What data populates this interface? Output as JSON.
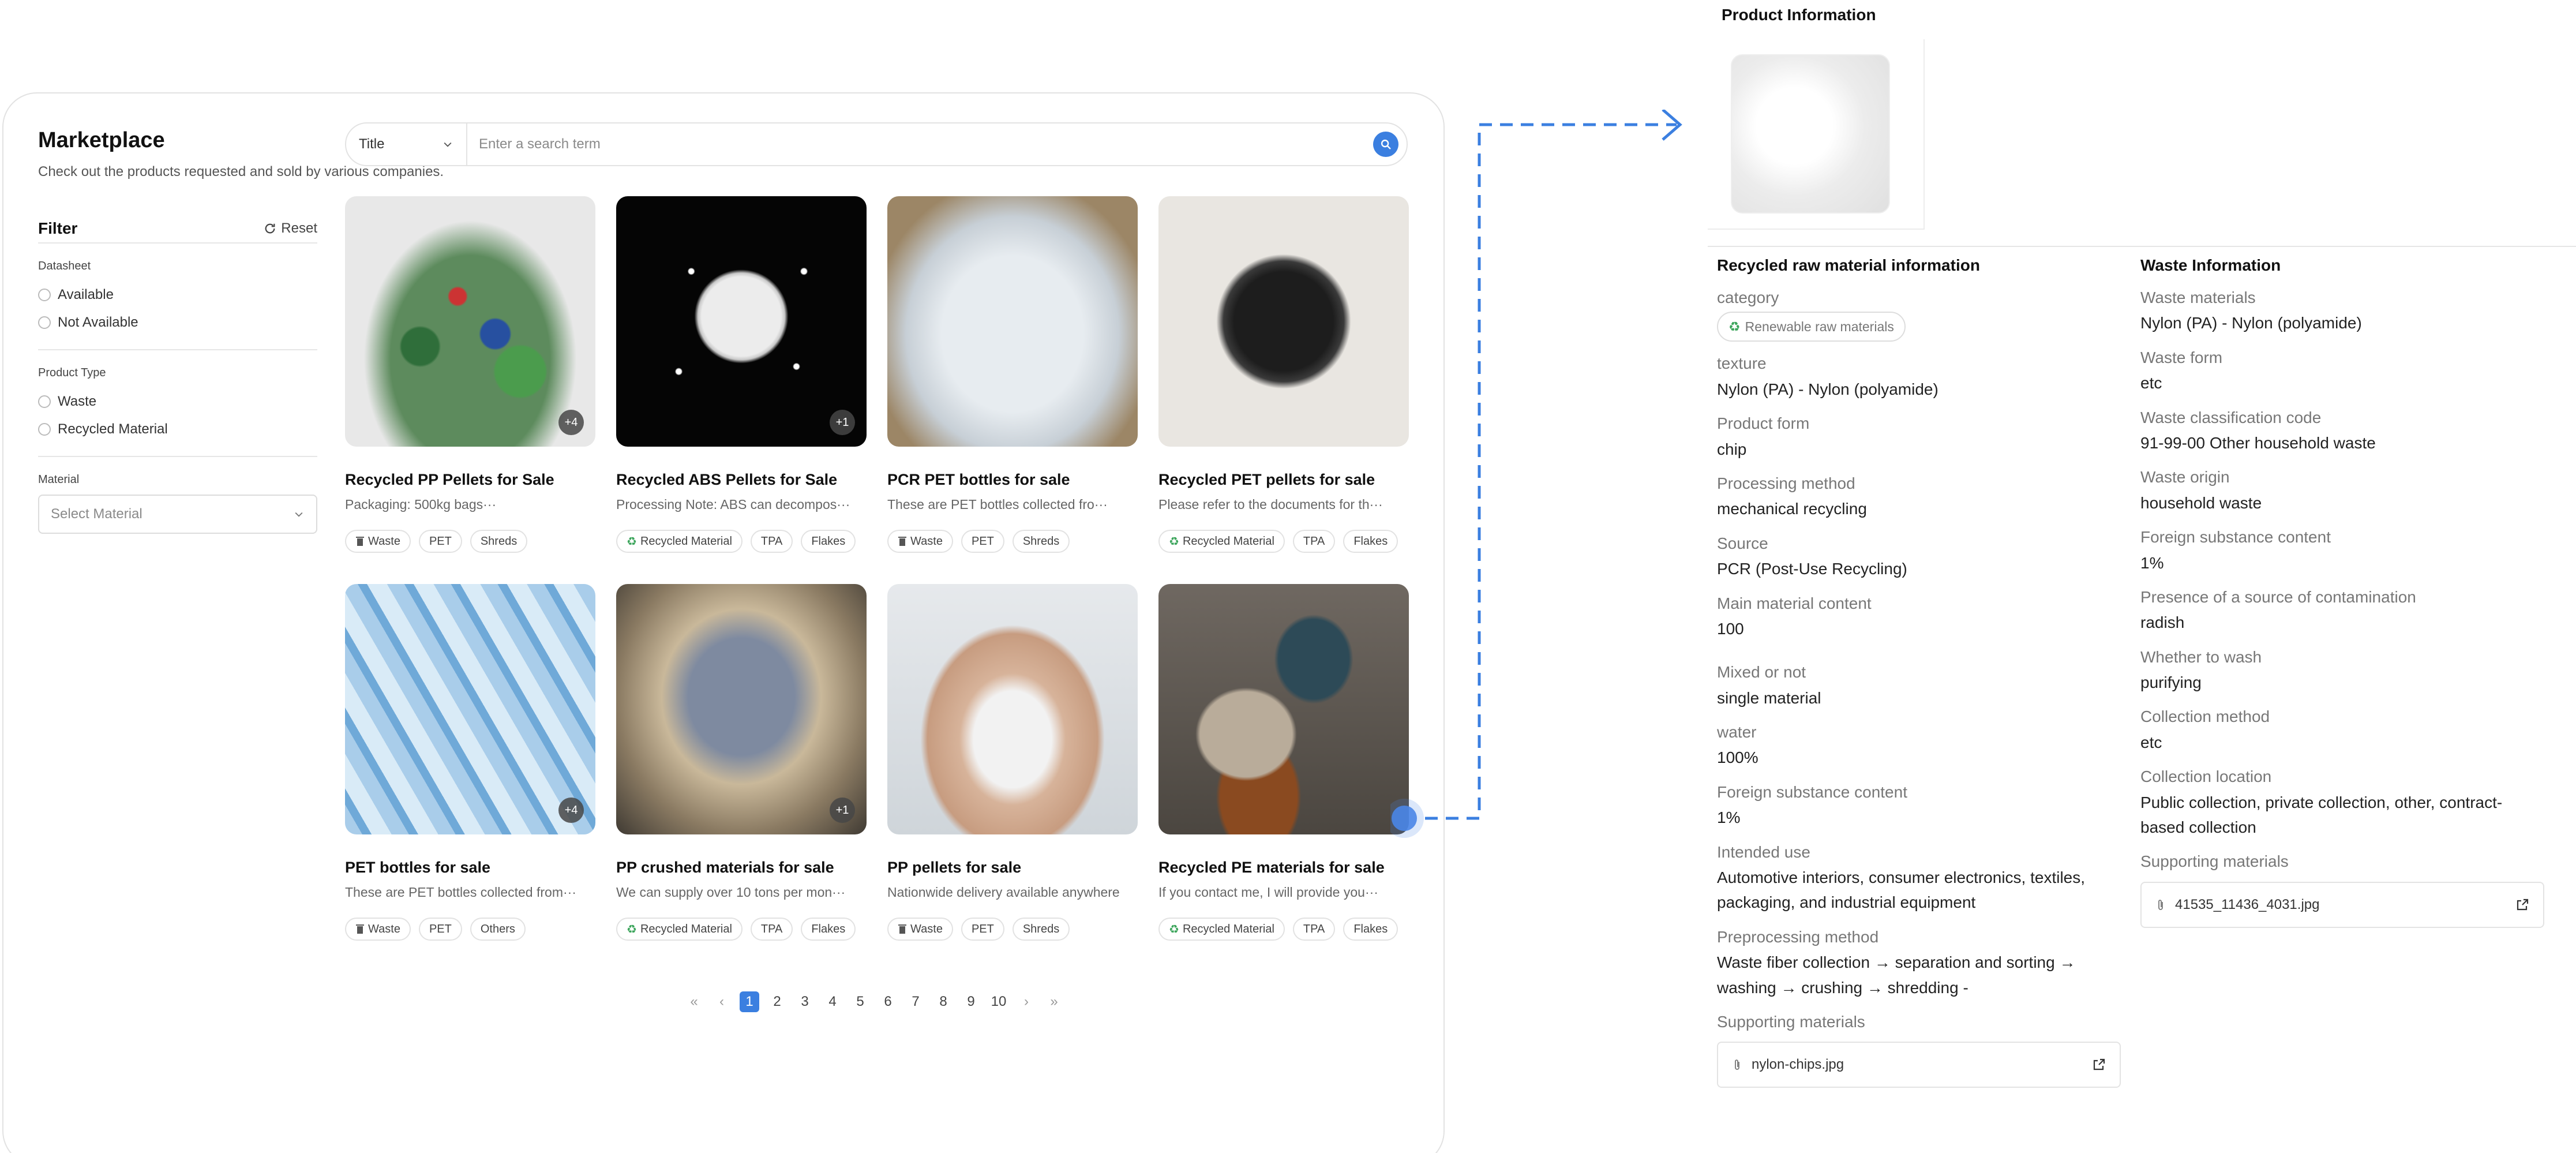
{
  "marketplace": {
    "title": "Marketplace",
    "subtitle": "Check out the products requested and sold by various companies."
  },
  "filter": {
    "title": "Filter",
    "reset_label": "Reset",
    "datasheet": {
      "label": "Datasheet",
      "options": [
        "Available",
        "Not Available"
      ]
    },
    "product_type": {
      "label": "Product Type",
      "options": [
        "Waste",
        "Recycled Material"
      ]
    },
    "material": {
      "label": "Material",
      "placeholder": "Select Material"
    }
  },
  "search": {
    "field": "Title",
    "placeholder": "Enter a search term"
  },
  "products": [
    {
      "title": "Recycled PP Pellets for Sale",
      "desc": "Packaging: 500kg bags···",
      "badge": "+4",
      "tags": [
        "Waste",
        "PET",
        "Shreds"
      ],
      "type_icon": "trash-icon",
      "image": "mixed-plastic-shreds"
    },
    {
      "title": "Recycled ABS Pellets for Sale",
      "desc": "Processing Note: ABS can decompos···",
      "badge": "+1",
      "tags": [
        "Recycled Material",
        "TPA",
        "Flakes"
      ],
      "type_icon": "recycle-icon",
      "image": "white-pellets-on-black"
    },
    {
      "title": "PCR PET bottles for sale",
      "desc": "These are PET bottles collected fro···",
      "badge": "",
      "tags": [
        "Waste",
        "PET",
        "Shreds"
      ],
      "type_icon": "trash-icon",
      "image": "clear-bottles-in-bag"
    },
    {
      "title": "Recycled PET pellets for sale",
      "desc": "Please refer to the documents for th···",
      "badge": "",
      "tags": [
        "Recycled Material",
        "TPA",
        "Flakes"
      ],
      "type_icon": "recycle-icon",
      "image": "black-pellets"
    },
    {
      "title": "PET bottles for sale",
      "desc": "These are PET bottles collected from···",
      "badge": "+4",
      "tags": [
        "Waste",
        "PET",
        "Others"
      ],
      "type_icon": "trash-icon",
      "image": "blue-bottles"
    },
    {
      "title": "PP crushed materials for sale",
      "desc": "We can supply over 10 tons per mon···",
      "badge": "+1",
      "tags": [
        "Recycled Material",
        "TPA",
        "Flakes"
      ],
      "type_icon": "recycle-icon",
      "image": "crushed-plastic-bag"
    },
    {
      "title": "PP pellets for sale",
      "desc": "Nationwide delivery available anywhere",
      "badge": "",
      "tags": [
        "Waste",
        "PET",
        "Shreds"
      ],
      "type_icon": "trash-icon",
      "image": "hand-clear-pellets"
    },
    {
      "title": "Recycled PE materials for sale",
      "desc": "If you contact me, I will provide you···",
      "badge": "",
      "tags": [
        "Recycled Material",
        "TPA",
        "Flakes"
      ],
      "type_icon": "recycle-icon",
      "image": "pellets-in-glasses"
    }
  ],
  "pagination": {
    "pages": [
      "1",
      "2",
      "3",
      "4",
      "5",
      "6",
      "7",
      "8",
      "9",
      "10"
    ],
    "current": "1"
  },
  "product_info": {
    "title": "Product Information",
    "recycled": {
      "title": "Recycled raw material information",
      "category_label": "category",
      "category_value": "Renewable raw materials",
      "fields": [
        {
          "label": "texture",
          "value": "Nylon (PA) - Nylon (polyamide)"
        },
        {
          "label": "Product form",
          "value": "chip"
        },
        {
          "label": "Processing method",
          "value": "mechanical recycling"
        },
        {
          "label": "Source",
          "value": "PCR (Post-Use Recycling)"
        },
        {
          "label": "Main material content",
          "value": "100"
        },
        {
          "label": "Mixed or not",
          "value": "single material"
        },
        {
          "label": "water",
          "value": "100%"
        },
        {
          "label": "Foreign substance content",
          "value": "1%"
        },
        {
          "label": "Intended use",
          "value": "Automotive interiors, consumer electronics, textiles, packaging, and industrial equipment"
        },
        {
          "label": "Preprocessing method",
          "value": "Waste fiber collection → separation and sorting → washing → crushing → shredding -"
        }
      ],
      "supporting_label": "Supporting materials",
      "file": "nylon-chips.jpg"
    },
    "waste": {
      "title": "Waste Information",
      "fields": [
        {
          "label": "Waste materials",
          "value": "Nylon (PA) - Nylon (polyamide)"
        },
        {
          "label": "Waste form",
          "value": "etc"
        },
        {
          "label": "Waste classification code",
          "value": "91-99-00 Other household waste"
        },
        {
          "label": "Waste origin",
          "value": "household waste"
        },
        {
          "label": "Foreign substance content",
          "value": "1%"
        },
        {
          "label": "Presence of a source of contamination",
          "value": "radish"
        },
        {
          "label": "Whether to wash",
          "value": "purifying"
        },
        {
          "label": "Collection method",
          "value": "etc"
        },
        {
          "label": "Collection location",
          "value": "Public collection, private collection, other, contract-based collection"
        }
      ],
      "supporting_label": "Supporting materials",
      "file": "41535_11436_4031.jpg"
    }
  },
  "colors": {
    "accent": "#3b7fe0",
    "recycle_green": "#3aa45a",
    "connector": "#3b7fe0"
  }
}
